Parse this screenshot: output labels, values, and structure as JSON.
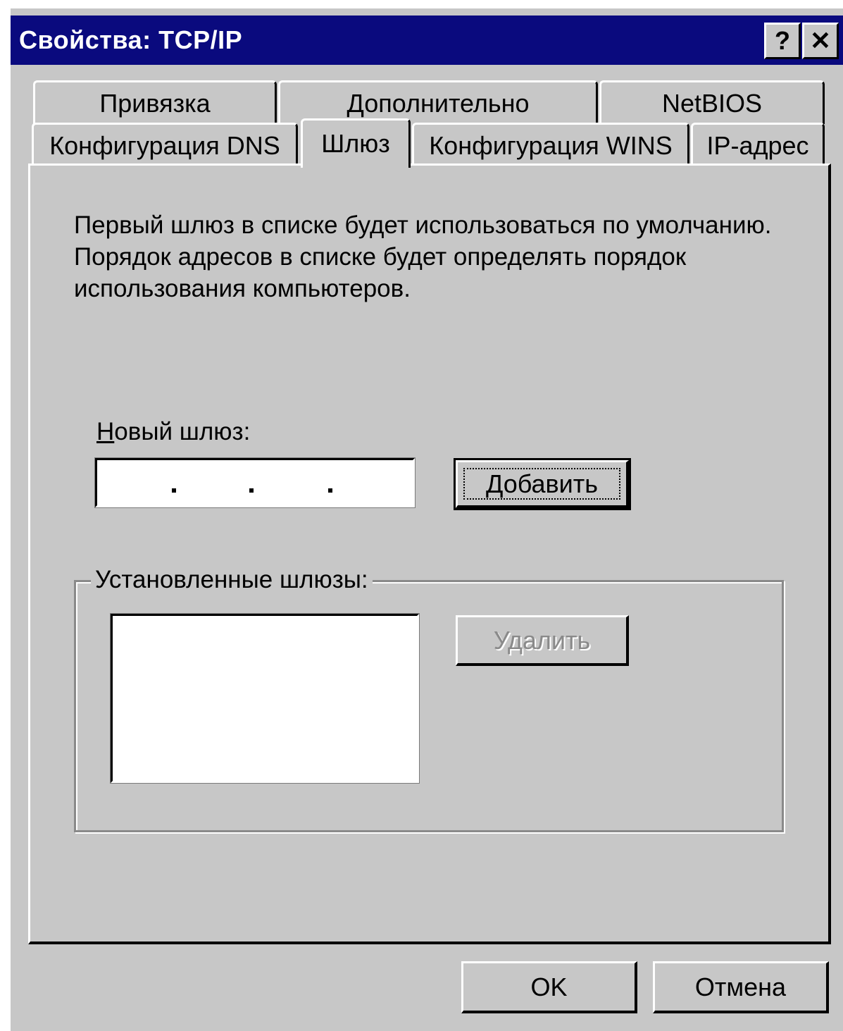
{
  "window": {
    "title": "Свойства: TCP/IP",
    "help_label": "?",
    "close_label": "✕"
  },
  "tabs": {
    "row1": [
      "Привязка",
      "Дополнительно",
      "NetBIOS"
    ],
    "row2": [
      "Конфигурация DNS",
      "Шлюз",
      "Конфигурация WINS",
      "IP-адрес"
    ],
    "active": "Шлюз"
  },
  "gateway": {
    "description": "Первый шлюз в списке будет использоваться по умолчанию. Порядок адресов в списке будет определять порядок использования компьютеров.",
    "new_gateway_label": "Новый шлюз:",
    "new_gateway_value": "",
    "add_button": "Добавить",
    "installed_label": "Установленные шлюзы:",
    "installed_items": [],
    "remove_button": "Удалить"
  },
  "footer": {
    "ok_button": "OK",
    "cancel_button": "Отмена"
  }
}
